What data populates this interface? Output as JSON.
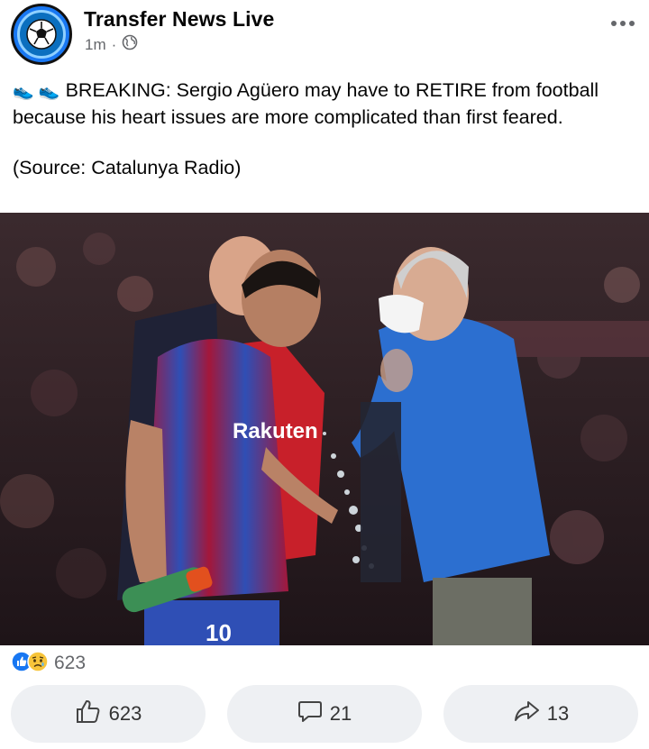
{
  "post": {
    "page_name": "Transfer News Live",
    "time": "1m",
    "separator": "·",
    "text_line1": "BREAKING: Sergio Agüero may have to RETIRE from football because his heart issues are more complicated than first feared.",
    "text_source": "(Source: Catalunya Radio)",
    "emoji": "👟 👟"
  },
  "photo": {
    "jersey_sponsor": "Rakuten",
    "jersey_number": "10"
  },
  "reactions": {
    "total": "623"
  },
  "actions": {
    "like_count": "623",
    "comment_count": "21",
    "share_count": "13"
  },
  "colors": {
    "like_blue": "#1877f2",
    "text_gray": "#65676b",
    "button_bg": "#eef0f3"
  }
}
